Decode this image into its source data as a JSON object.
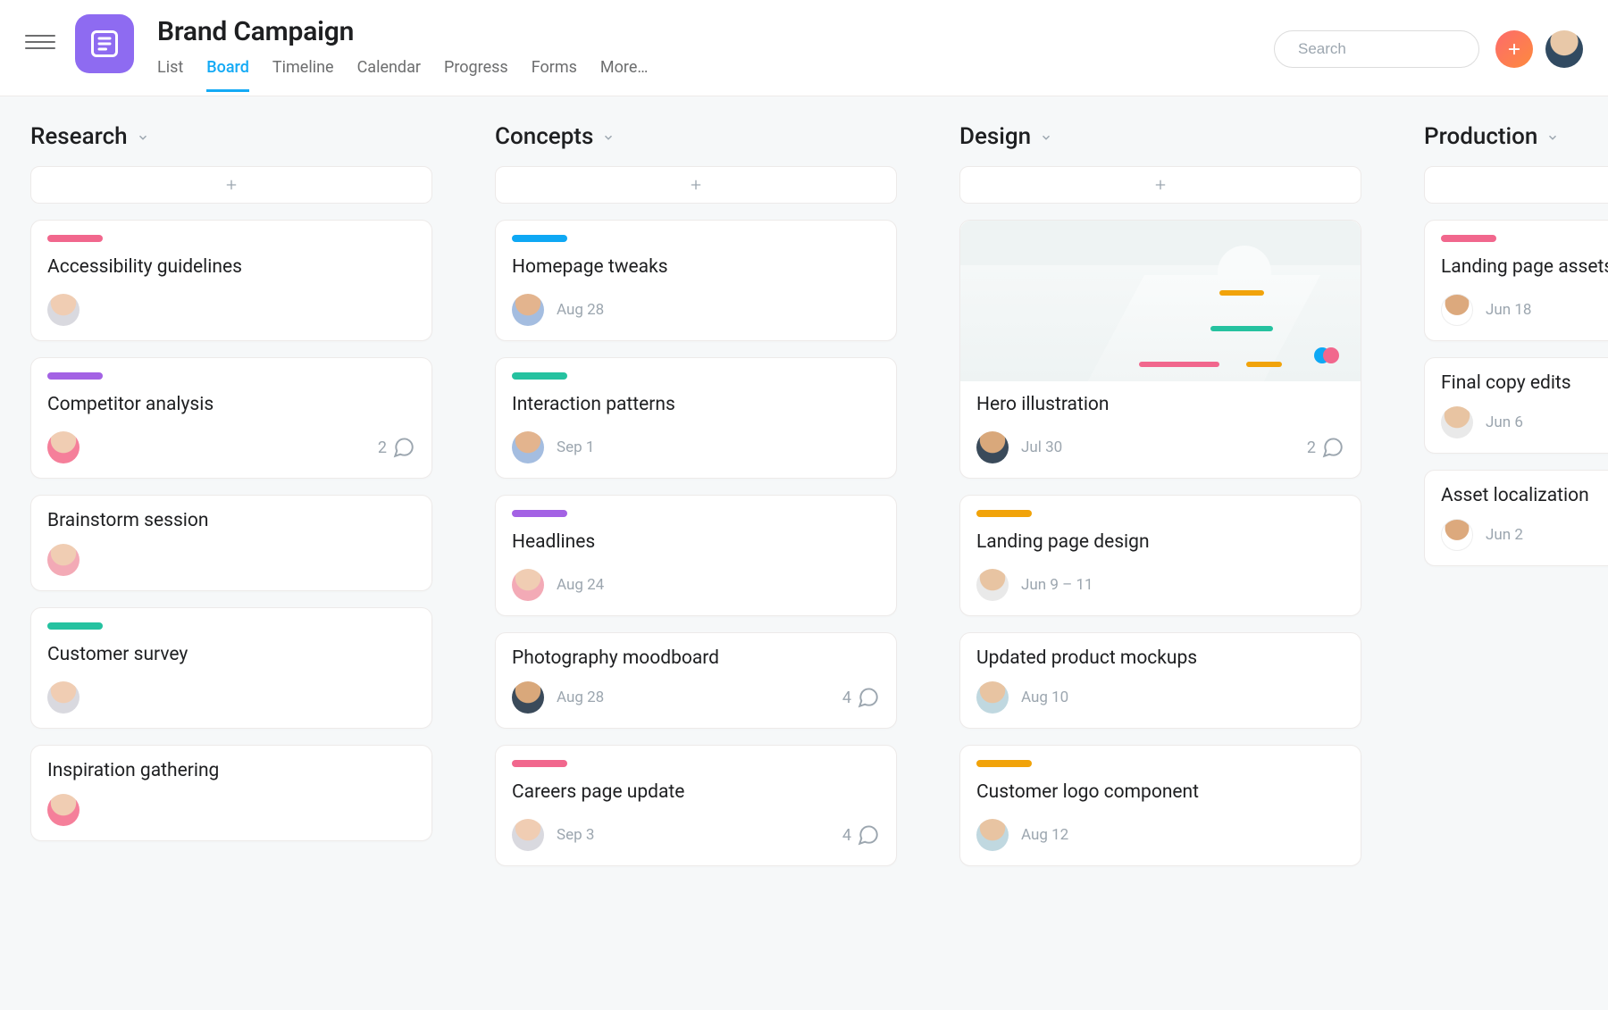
{
  "project": {
    "title": "Brand Campaign"
  },
  "tabs": [
    "List",
    "Board",
    "Timeline",
    "Calendar",
    "Progress",
    "Forms",
    "More…"
  ],
  "active_tab": "Board",
  "search": {
    "placeholder": "Search"
  },
  "colors": {
    "pink": "#f1678d",
    "purple": "#a362e4",
    "teal": "#25c2a0",
    "blue": "#0ea8f4",
    "orange": "#f1a30a"
  },
  "columns": [
    {
      "name": "Research",
      "cards": [
        {
          "tag": "pink",
          "title": "Accessibility guidelines",
          "avatar": "av1"
        },
        {
          "tag": "purple",
          "title": "Competitor analysis",
          "avatar": "av2",
          "comments": 2
        },
        {
          "title": "Brainstorm session",
          "avatar": "av4"
        },
        {
          "tag": "teal",
          "title": "Customer survey",
          "avatar": "av1"
        },
        {
          "title": "Inspiration gathering",
          "avatar": "av2"
        }
      ]
    },
    {
      "name": "Concepts",
      "cards": [
        {
          "tag": "blue",
          "title": "Homepage tweaks",
          "avatar": "av3",
          "due": "Aug 28"
        },
        {
          "tag": "teal",
          "title": "Interaction patterns",
          "avatar": "av3",
          "due": "Sep 1"
        },
        {
          "tag": "purple",
          "title": "Headlines",
          "avatar": "av4",
          "due": "Aug 24"
        },
        {
          "title": "Photography moodboard",
          "avatar": "av5",
          "due": "Aug 28",
          "comments": 4
        },
        {
          "tag": "pink",
          "title": "Careers page update",
          "avatar": "av1",
          "due": "Sep 3",
          "comments": 4
        }
      ]
    },
    {
      "name": "Design",
      "cards": [
        {
          "cover": true,
          "title": "Hero illustration",
          "avatar": "av5",
          "due": "Jul 30",
          "comments": 2
        },
        {
          "tag": "orange",
          "title": "Landing page design",
          "avatar": "av7",
          "due": "Jun 9 – 11"
        },
        {
          "title": "Updated product mockups",
          "avatar": "av6",
          "due": "Aug 10"
        },
        {
          "tag": "orange",
          "title": "Customer logo component",
          "avatar": "av6",
          "due": "Aug 12"
        }
      ]
    },
    {
      "name": "Production",
      "cards": [
        {
          "tag": "pink",
          "title": "Landing page assets",
          "avatar": "av8",
          "due": "Jun 18"
        },
        {
          "title": "Final copy edits",
          "avatar": "av7",
          "due": "Jun 6"
        },
        {
          "title": "Asset localization",
          "avatar": "av8",
          "due": "Jun 2"
        }
      ]
    }
  ]
}
